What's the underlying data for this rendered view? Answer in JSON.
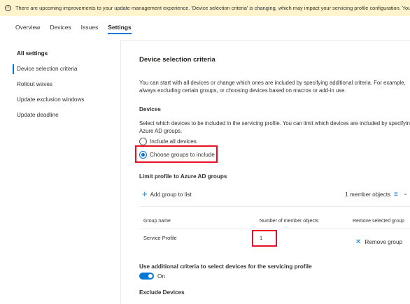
{
  "banner": {
    "icon": "info-icon",
    "text": "There are upcoming improvements to your update management experience. 'Device selection criteria' is changing, which may impact your servicing profile configuration. You can learn more"
  },
  "tabs": [
    {
      "label": "Overview"
    },
    {
      "label": "Devices"
    },
    {
      "label": "Issues"
    },
    {
      "label": "Settings",
      "active": true
    }
  ],
  "sidebar": {
    "heading": "All settings",
    "items": [
      {
        "label": "Device selection criteria",
        "selected": true
      },
      {
        "label": "Rollout waves"
      },
      {
        "label": "Update exclusion windows"
      },
      {
        "label": "Update deadline"
      }
    ]
  },
  "main": {
    "title": "Device selection criteria",
    "intro_line1": "You can start with all devices or change which ones are included by specifying additional criteria. For example,",
    "intro_line2": "always excluding certain groups, or choosing devices based on macros or add-in use.",
    "devices_heading": "Devices",
    "devices_desc_line1": "Select which devices to be included in the servicing profile. You can limit which devices are included by specifying",
    "devices_desc_line2": "Azure AD groups.",
    "radio_all": "Include all devices",
    "radio_groups": "Choose groups to include",
    "limit_heading": "Limit profile to Azure AD groups",
    "add_group": "Add group to list",
    "member_objects": "1 member objects",
    "table": {
      "headers": [
        "Group name",
        "Number of member objects",
        "Remove selected group"
      ],
      "rows": [
        {
          "name": "Service Profile",
          "count": "1",
          "action": "Remove group"
        }
      ]
    },
    "criteria_heading": "Use additional criteria to select devices for the servicing profile",
    "toggle_label": "On",
    "toggle_on": true,
    "exclude_heading": "Exclude Devices"
  },
  "colors": {
    "accent": "#0078d4",
    "banner_bg": "#fff4ce",
    "highlight": "#e81123"
  }
}
